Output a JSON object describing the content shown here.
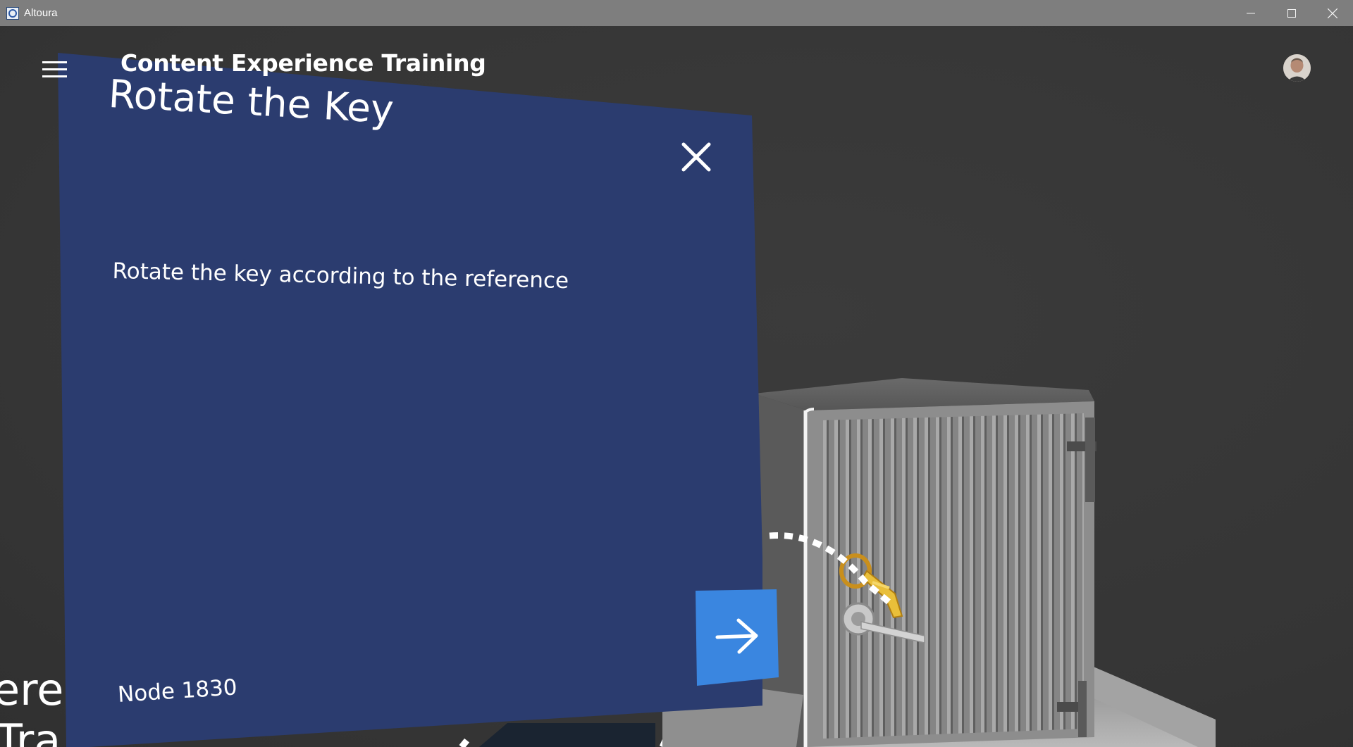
{
  "window": {
    "title": "Altoura",
    "controls": [
      "minimize-icon",
      "maximize-icon",
      "close-icon"
    ]
  },
  "header": {
    "menu_icon": "hamburger-menu-icon",
    "app_title": "Content Experience Training",
    "avatar": "user-avatar"
  },
  "panel": {
    "title": "Rotate the Key",
    "close_icon": "close-x-icon",
    "description": "Rotate the key according to the reference",
    "node_label": "Node 1830",
    "next_icon": "arrow-right-icon"
  },
  "background_text": {
    "fragment_1": "ere",
    "fragment_2": "Tra"
  },
  "colors": {
    "panel": "#2b3c6f",
    "next_button": "#3a86e0",
    "titlebar": "#7e7e7e",
    "scene": "#373737"
  }
}
